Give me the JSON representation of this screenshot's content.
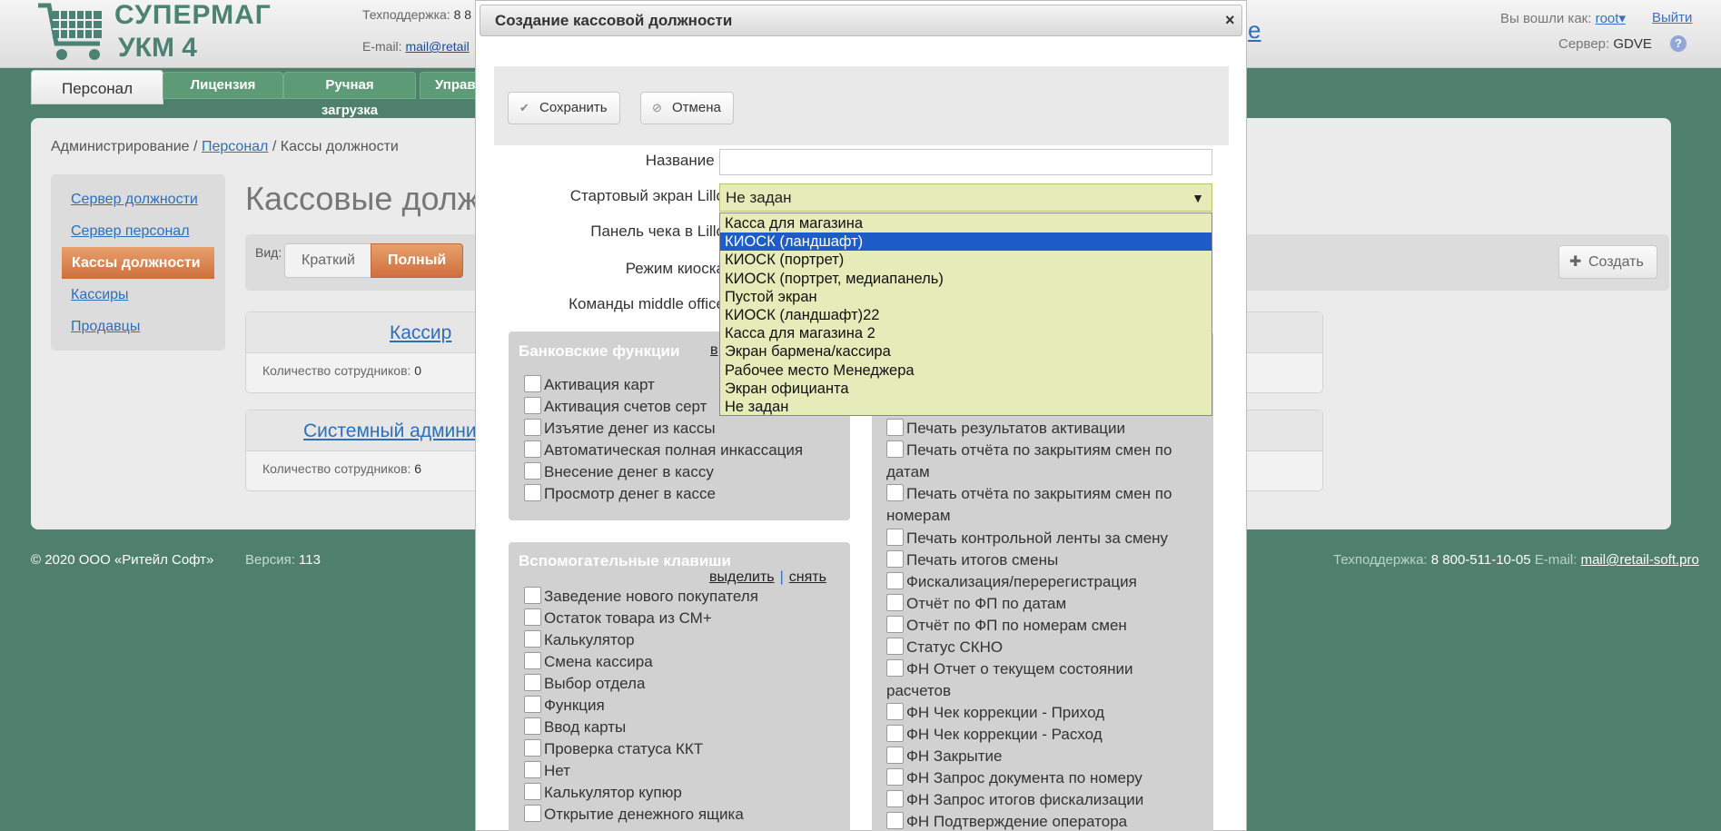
{
  "header": {
    "logo_line1": "СУПЕРМАГ",
    "logo_line2": "УКМ 4",
    "support_label": "Техподдержка:",
    "support_phone": "8 8",
    "email_label": "E-mail:",
    "email_value": "mail@retail",
    "partial_link": "e",
    "logged_in_label": "Вы вошли как:",
    "user": "root",
    "logout": "Выйти",
    "server_label": "Сервер:",
    "server_value": "GDVE",
    "help": "?"
  },
  "tabs": [
    {
      "label": "Персонал"
    },
    {
      "label": "Лицензия"
    },
    {
      "label": "Ручная загрузка"
    },
    {
      "label": "Управ"
    }
  ],
  "breadcrumb": {
    "admin": "Администрирование",
    "sep1": "/",
    "personnel": "Персонал",
    "sep2": "/",
    "current": "Кассы должности"
  },
  "sidebar": {
    "items": [
      {
        "label": "Сервер должности"
      },
      {
        "label": "Сервер персонал"
      },
      {
        "label": "Кассы должности"
      },
      {
        "label": "Кассиры"
      },
      {
        "label": "Продавцы"
      }
    ]
  },
  "page": {
    "title": "Кассовые долж",
    "view_label": "Вид:",
    "view_short": "Краткий",
    "view_full": "Полный",
    "create": "Создать"
  },
  "cards": [
    {
      "title": "Кассир",
      "count_label": "Количество сотрудников:",
      "count": "0"
    },
    {
      "title": "Системный админис",
      "count_label": "Количество сотрудников:",
      "count": "6"
    }
  ],
  "footer": {
    "copyright": "© 2020 ООО «Ритейл Софт»",
    "version_label": "Версия:",
    "version": "113",
    "support_label": "Техподдержка:",
    "support_phone": "8 800-511-10-05",
    "email_label": "E-mail:",
    "email": "mail@retail-soft.pro"
  },
  "modal": {
    "title": "Создание кассовой должности",
    "close": "×",
    "save": "Сохранить",
    "cancel": "Отмена",
    "fields": {
      "name_label": "Название *",
      "name_value": "",
      "start_screen_label": "Стартовый экран Lillo",
      "start_screen_value": "Не задан",
      "receipt_panel_label": "Панель чека в Lillo",
      "kiosk_mode_label": "Режим киоска",
      "middle_office_label": "Команды middle office"
    },
    "dropdown_options": [
      "Касса для магазина",
      "КИОСК (ландшафт)",
      "КИОСК (портрет)",
      "КИОСК (портрет, медиапанель)",
      "Пустой экран",
      "КИОСК (ландшафт)22",
      "Касса для магазина 2",
      "Экран бармена/кассира",
      "Рабочее место Менеджера",
      "Экран официанта",
      "Не задан"
    ],
    "dropdown_selected_index": 1,
    "bank_group": {
      "title": "Банковские функции",
      "link_partial": "в",
      "items": [
        "Активация карт",
        "Активация счетов серт",
        "Изъятие денег из кассы",
        "Автоматическая полная инкассация",
        "Внесение денег в кассу",
        "Просмотр денег в кассе"
      ]
    },
    "aux_group": {
      "title": "Вспомогательные клавиши",
      "select_all": "выделить",
      "sep": "|",
      "clear": "снять",
      "items": [
        "Заведение нового покупателя",
        "Остаток товара из СМ+",
        "Калькулятор",
        "Смена кассира",
        "Выбор отдела",
        "Функция",
        "Ввод карты",
        "Проверка статуса ККТ",
        "Нет",
        "Калькулятор купюр",
        "Открытие денежного ящика"
      ]
    },
    "right_group": {
      "items": [
        "Печать результатов активации",
        "Печать отчёта по закрытиям смен по датам",
        "Печать отчёта по закрытиям смен по номерам",
        "Печать контрольной ленты за смену",
        "Печать итогов смены",
        "Фискализация/перерегистрация",
        "Отчёт по ФП по датам",
        "Отчёт по ФП по номерам смен",
        "Статус СКНО",
        "ФН Отчет о текущем состоянии расчетов",
        "ФН Чек коррекции - Приход",
        "ФН Чек коррекции - Расход",
        "ФН Закрытие",
        "ФН Запрос документа по номеру",
        "ФН Запрос итогов фискализации",
        "ФН Подтверждение оператора"
      ]
    }
  }
}
